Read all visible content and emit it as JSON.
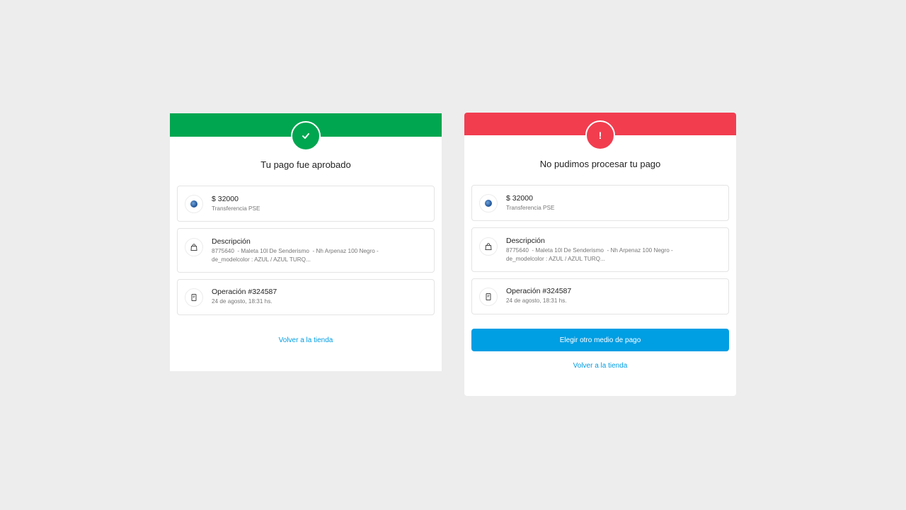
{
  "colors": {
    "success": "#00a650",
    "error": "#f23d4f",
    "accent": "#009ee3",
    "background": "#ededed"
  },
  "success_card": {
    "status_icon": "check-icon",
    "title": "Tu pago fue aprobado",
    "amount": "$ 32000",
    "payment_method": "Transferencia PSE",
    "description_label": "Descripción",
    "description_line1": "8775640  - Maleta 10l De Senderismo  - Nh Arpenaz 100 Negro -",
    "description_line2": "de_modelcolor : AZUL / AZUL TURQ...",
    "operation_label": "Operación #324587",
    "operation_date": "24 de agosto, 18:31 hs.",
    "back_link": "Volver a la tienda"
  },
  "error_card": {
    "status_icon": "exclamation-icon",
    "status_symbol": "!",
    "title": "No pudimos procesar tu pago",
    "amount": "$ 32000",
    "payment_method": "Transferencia PSE",
    "description_label": "Descripción",
    "description_line1": "8775640  - Maleta 10l De Senderismo  - Nh Arpenaz 100 Negro -",
    "description_line2": "de_modelcolor : AZUL / AZUL TURQ...",
    "operation_label": "Operación #324587",
    "operation_date": "24 de agosto, 18:31 hs.",
    "retry_button": "Elegir otro medio de pago",
    "back_link": "Volver a la tienda"
  }
}
